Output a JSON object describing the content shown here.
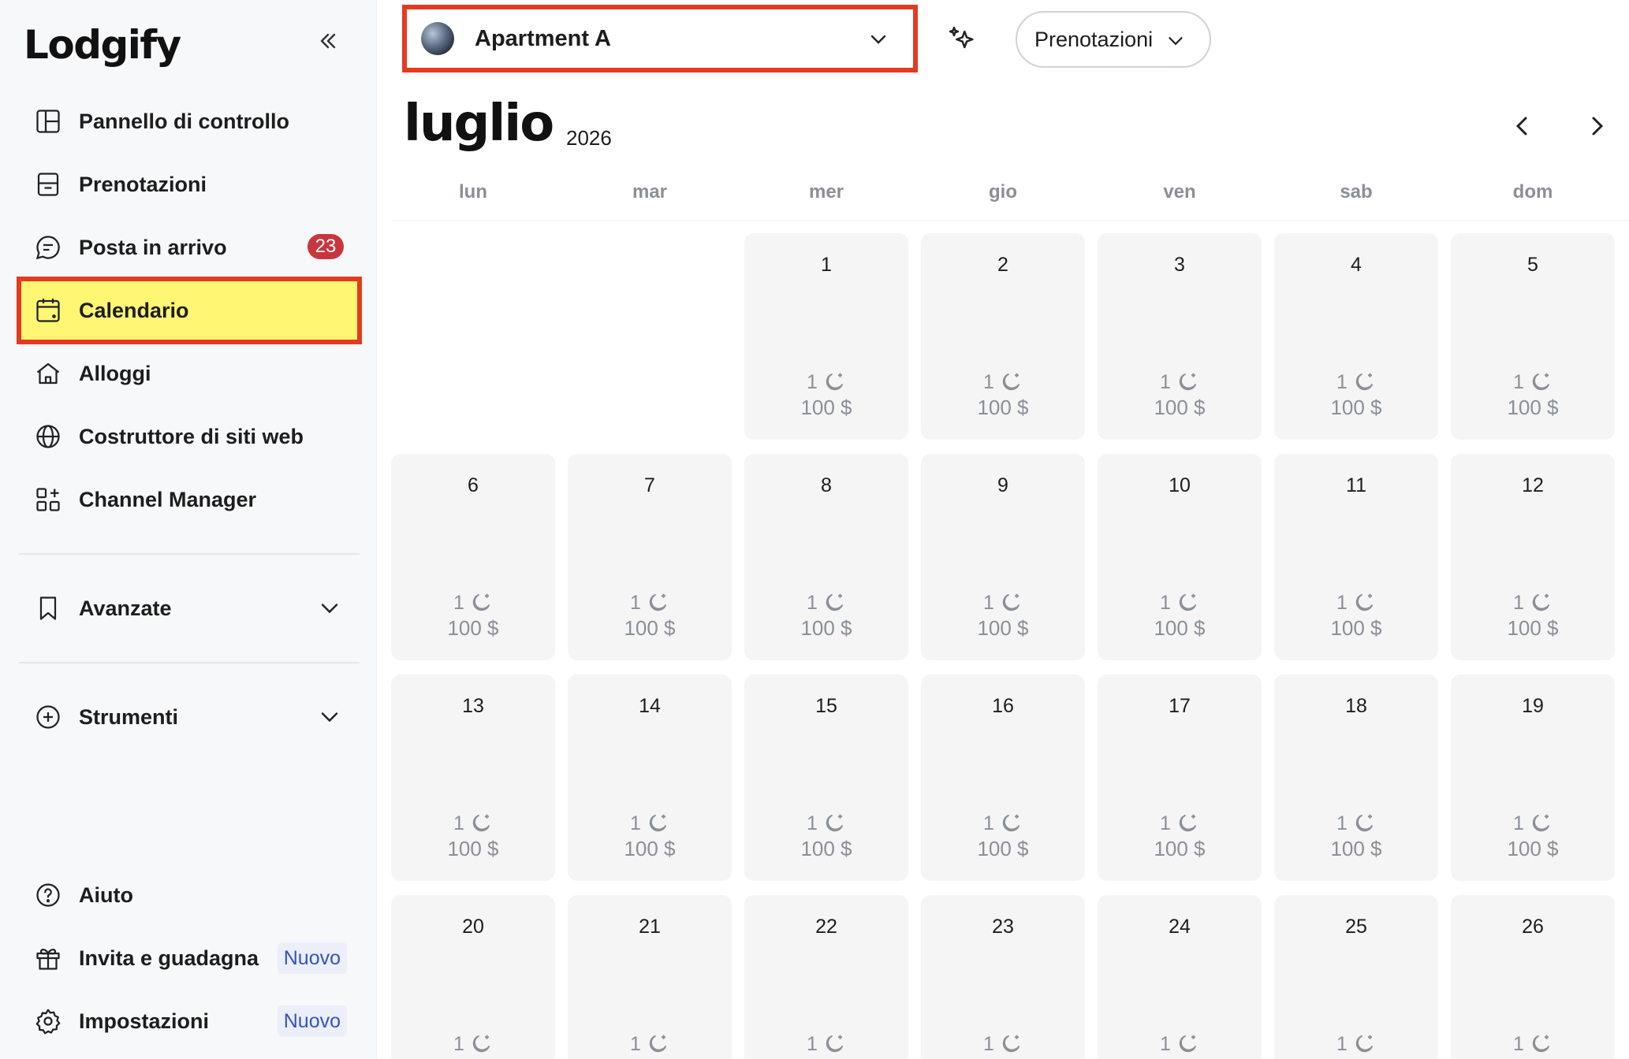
{
  "app": {
    "logo": "Lodgify"
  },
  "sidebar": {
    "collapse_icon": "double-chevron-left-icon",
    "items": [
      {
        "label": "Pannello di controllo",
        "icon": "dashboard-icon"
      },
      {
        "label": "Prenotazioni",
        "icon": "bookings-icon"
      },
      {
        "label": "Posta in arrivo",
        "icon": "inbox-icon",
        "badge": "23"
      },
      {
        "label": "Calendario",
        "icon": "calendar-icon",
        "active": true
      },
      {
        "label": "Alloggi",
        "icon": "house-icon"
      },
      {
        "label": "Costruttore di siti web",
        "icon": "globe-icon"
      },
      {
        "label": "Channel Manager",
        "icon": "apps-add-icon"
      }
    ],
    "sections": [
      {
        "label": "Avanzate",
        "icon": "bookmark-icon"
      },
      {
        "label": "Strumenti",
        "icon": "plus-circle-icon"
      }
    ],
    "footer": [
      {
        "label": "Aiuto",
        "icon": "help-icon"
      },
      {
        "label": "Invita e guadagna",
        "icon": "gift-icon",
        "tag": "Nuovo"
      },
      {
        "label": "Impostazioni",
        "icon": "gear-icon",
        "tag": "Nuovo"
      }
    ]
  },
  "topbar": {
    "property": "Apartment A",
    "view_selector": "Prenotazioni"
  },
  "calendar": {
    "month": "luglio",
    "year": "2026",
    "weekdays": [
      "lun",
      "mar",
      "mer",
      "gio",
      "ven",
      "sab",
      "dom"
    ],
    "first_weekday_index": 2,
    "visible_days": [
      1,
      2,
      3,
      4,
      5,
      6,
      7,
      8,
      9,
      10,
      11,
      12,
      13,
      14,
      15,
      16,
      17,
      18,
      19,
      20,
      21,
      22,
      23,
      24,
      25,
      26
    ],
    "min_stay": "1",
    "price": "100 $",
    "price_hidden_from_day": 20
  },
  "colors": {
    "highlight": "#fff673",
    "annotation_border": "#e53a22",
    "badge_red": "#c9353c",
    "tag_blue": "#3452c9",
    "cell_bg": "#f5f5f6"
  }
}
